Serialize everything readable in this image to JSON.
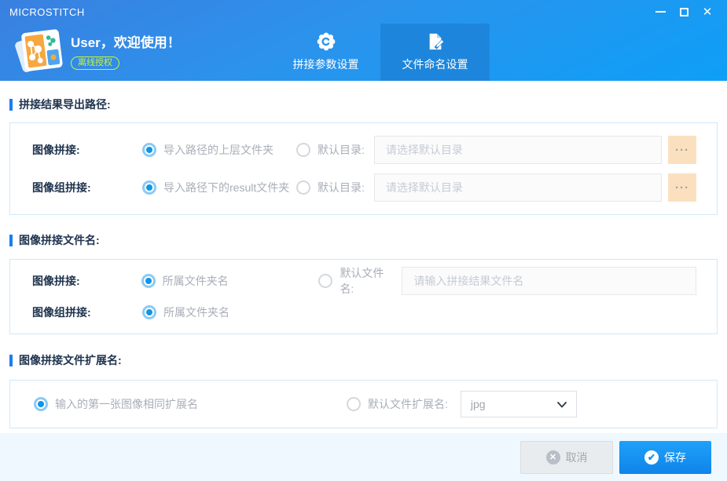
{
  "window": {
    "title": "MICROSTITCH",
    "controls": {
      "close_glyph": "✕"
    }
  },
  "header": {
    "welcome": "User，欢迎使用！",
    "badge": "离线授权",
    "tabs": [
      {
        "label": "拼接参数设置",
        "icon": "gear-icon",
        "active": false
      },
      {
        "label": "文件命名设置",
        "icon": "document-edit-icon",
        "active": true
      }
    ]
  },
  "sections": [
    {
      "title": "拼接结果导出路径:",
      "rows": [
        {
          "label": "图像拼接:",
          "radio1": "导入路径的上层文件夹",
          "radio1_selected": true,
          "radio2": "默认目录:",
          "radio2_selected": false,
          "placeholder": "请选择默认目录",
          "browse": "···"
        },
        {
          "label": "图像组拼接:",
          "radio1": "导入路径下的result文件夹",
          "radio1_selected": true,
          "radio2": "默认目录:",
          "radio2_selected": false,
          "placeholder": "请选择默认目录",
          "browse": "···"
        }
      ]
    },
    {
      "title": "图像拼接文件名:",
      "rows": [
        {
          "label": "图像拼接:",
          "radio1": "所属文件夹名",
          "radio1_selected": true,
          "radio2": "默认文件名:",
          "radio2_selected": false,
          "placeholder": "请输入拼接结果文件名"
        },
        {
          "label": "图像组拼接:",
          "radio1": "所属文件夹名",
          "radio1_selected": true
        }
      ]
    },
    {
      "title": "图像拼接文件扩展名:",
      "radio1": "输入的第一张图像相同扩展名",
      "radio1_selected": true,
      "radio2": "默认文件扩展名:",
      "radio2_selected": false,
      "select_value": "jpg"
    }
  ],
  "footer": {
    "cancel": "取消",
    "cancel_icon": "✕",
    "save": "保存",
    "save_icon": "✔"
  },
  "colors": {
    "accent": "#1490f5",
    "header_top": "#3a80e0",
    "header_bottom": "#0d9ff7",
    "active_tab": "#1d86dc",
    "badge": "#c9f53f",
    "browse_bg": "#fbe0c0",
    "footer_bg": "#eef8fe",
    "panel_border": "#cfe8f9",
    "section_text": "#20344f",
    "radio_dot": "#0d96ea"
  }
}
